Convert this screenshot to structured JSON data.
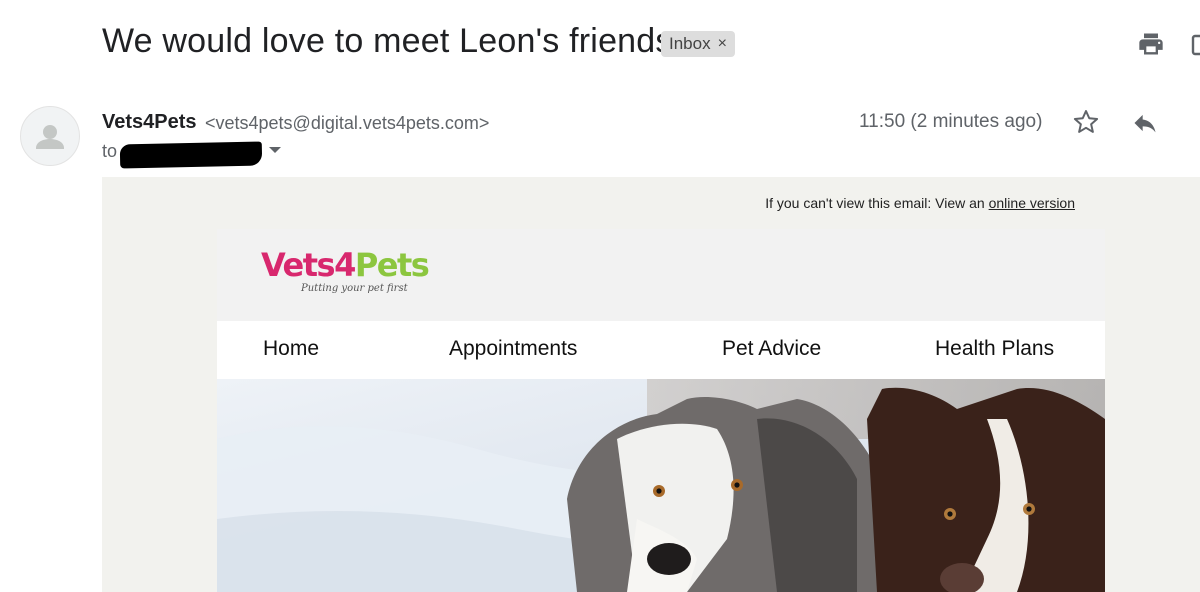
{
  "email": {
    "subject": "We would love to meet Leon's friends",
    "label": "Inbox",
    "label_remove": "×",
    "sender_name": "Vets4Pets",
    "sender_email": "<vets4pets@digital.vets4pets.com>",
    "to_prefix": "to",
    "timestamp": "11:50 (2 minutes ago)"
  },
  "icons": {
    "print": "print-icon",
    "new_window": "open-in-new-window-icon",
    "avatar": "default-avatar-icon",
    "caret": "chevron-down-icon",
    "star": "star-icon",
    "reply": "reply-icon"
  },
  "newsletter": {
    "view_online_prefix": "If you can't view this email: View an",
    "view_online_link": "online version",
    "brand_part1": "Vets",
    "brand_part2": "4",
    "brand_part3": "Pets",
    "brand_tagline": "Putting your pet first",
    "nav": [
      "Home",
      "Appointments",
      "Pet Advice",
      "Health Plans"
    ]
  },
  "colors": {
    "brand_magenta": "#d8286e",
    "brand_green": "#8cc63f",
    "body_bg": "#f2f2ee"
  }
}
